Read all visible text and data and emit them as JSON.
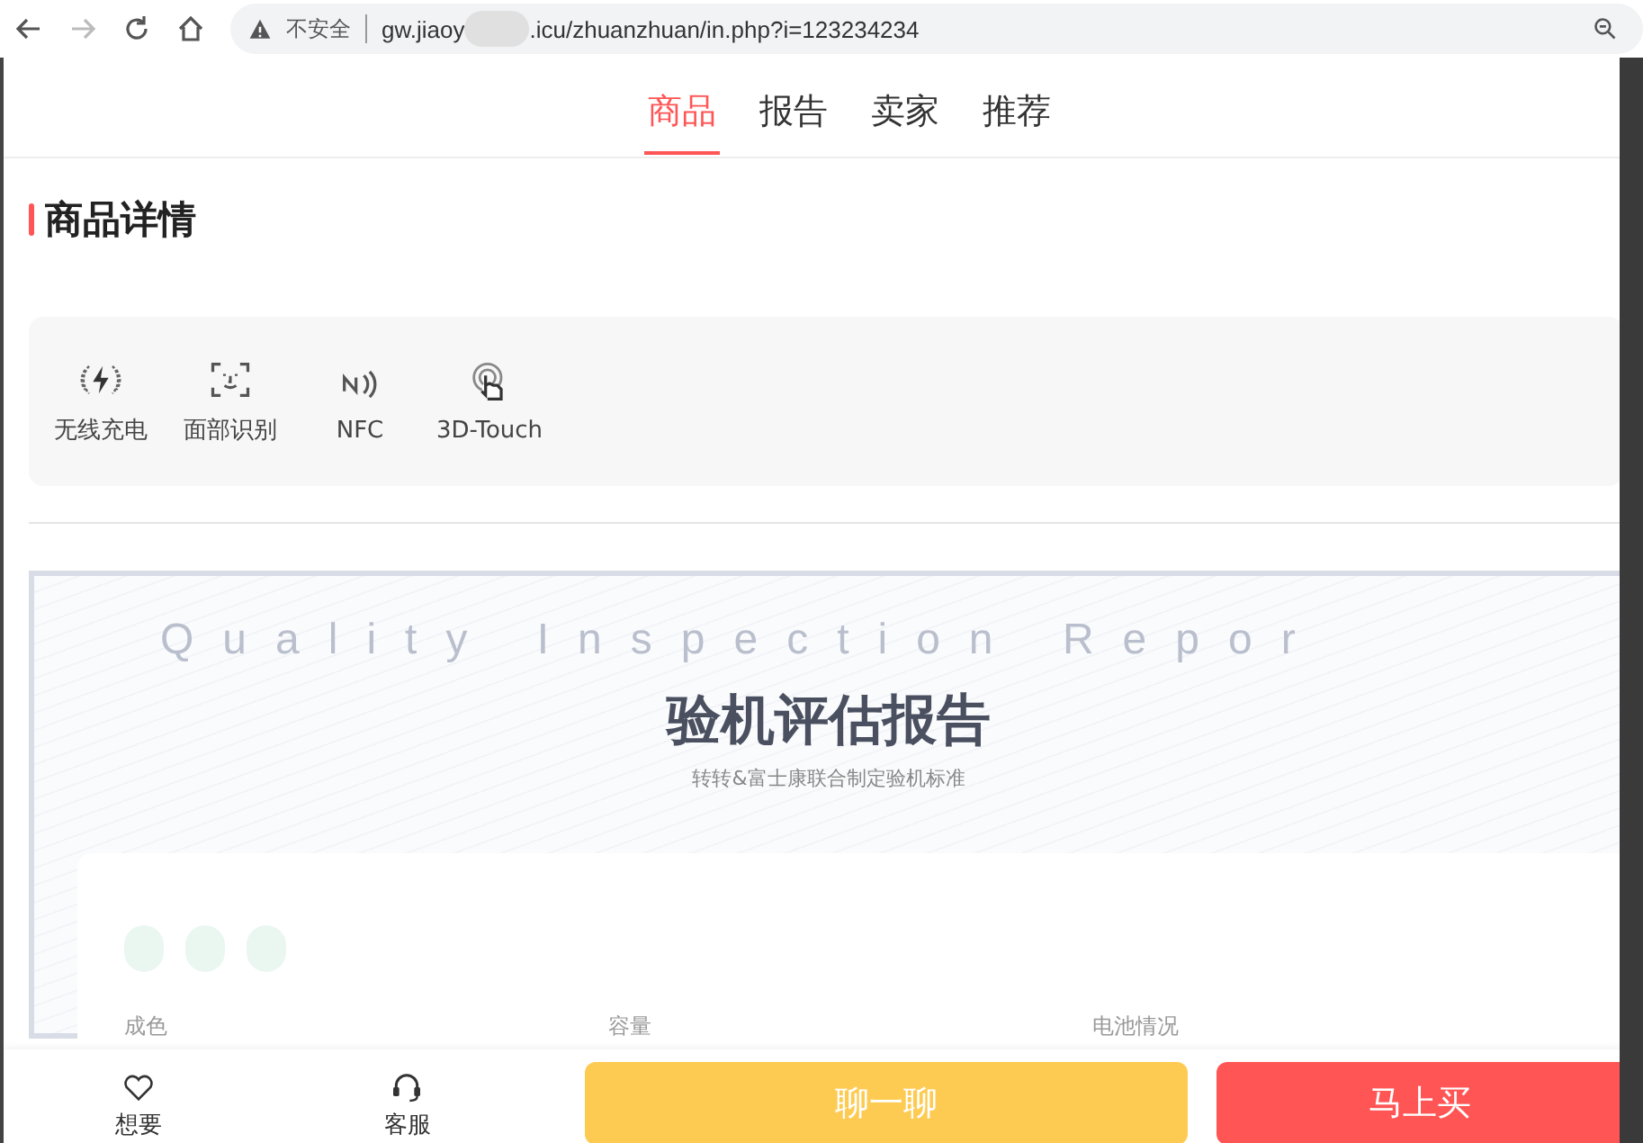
{
  "browser": {
    "security_label": "不安全",
    "url_start": "gw.jiaoy",
    "url_end": ".icu/zhuanzhuan/in.php?i=123234234"
  },
  "tabs": [
    {
      "label": "商品",
      "selected": true
    },
    {
      "label": "报告",
      "selected": false
    },
    {
      "label": "卖家",
      "selected": false
    },
    {
      "label": "推荐",
      "selected": false
    }
  ],
  "section_title": "商品详情",
  "features": [
    {
      "kind": "wireless",
      "label": "无线充电"
    },
    {
      "kind": "face",
      "label": "面部识别"
    },
    {
      "kind": "nfc",
      "label": "NFC"
    },
    {
      "kind": "touch",
      "label": "3D-Touch"
    }
  ],
  "report": {
    "watermark": "Quality Inspection Repor",
    "title": "验机评估报告",
    "subtitle": "转转&富士康联合制定验机标准",
    "fields": [
      "成色",
      "容量",
      "电池情况"
    ]
  },
  "bottom_bar": {
    "actions": [
      {
        "kind": "heart",
        "label": "想要"
      },
      {
        "kind": "headset",
        "label": "客服"
      }
    ],
    "chat_button": "聊一聊",
    "buy_button": "马上买"
  }
}
